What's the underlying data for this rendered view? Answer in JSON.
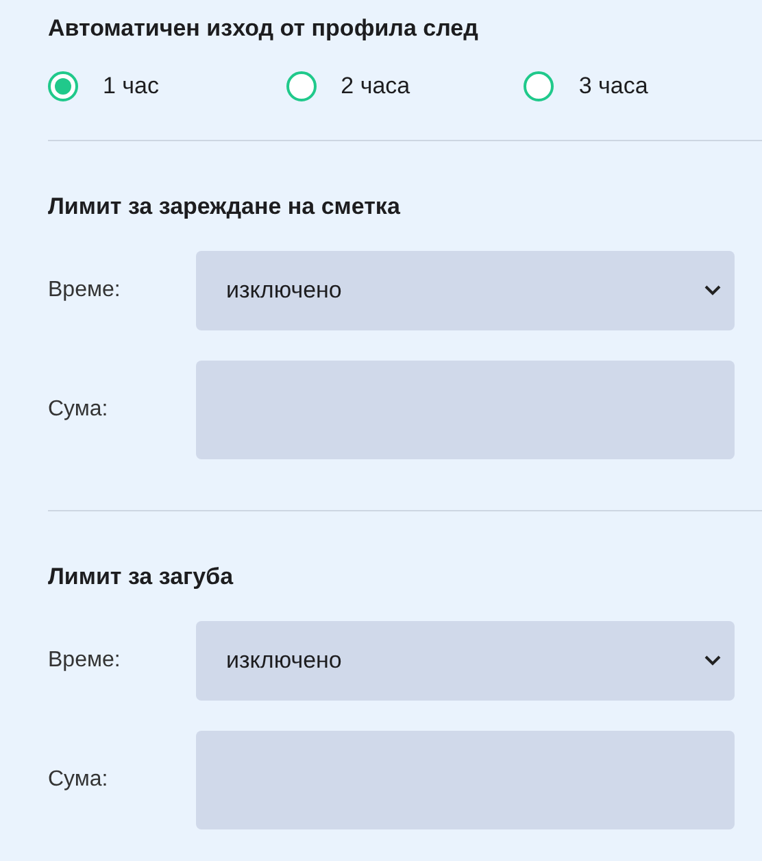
{
  "auto_logout": {
    "title": "Автоматичен изход от профила след",
    "options": [
      {
        "label": "1 час",
        "selected": true
      },
      {
        "label": "2 часа",
        "selected": false
      },
      {
        "label": "3 часа",
        "selected": false
      }
    ]
  },
  "sections": [
    {
      "title": "Лимит за зареждане на сметка",
      "time_label": "Време:",
      "time_value": "изключено",
      "amount_label": "Сума:"
    },
    {
      "title": "Лимит за загуба",
      "time_label": "Време:",
      "time_value": "изключено",
      "amount_label": "Сума:"
    }
  ]
}
